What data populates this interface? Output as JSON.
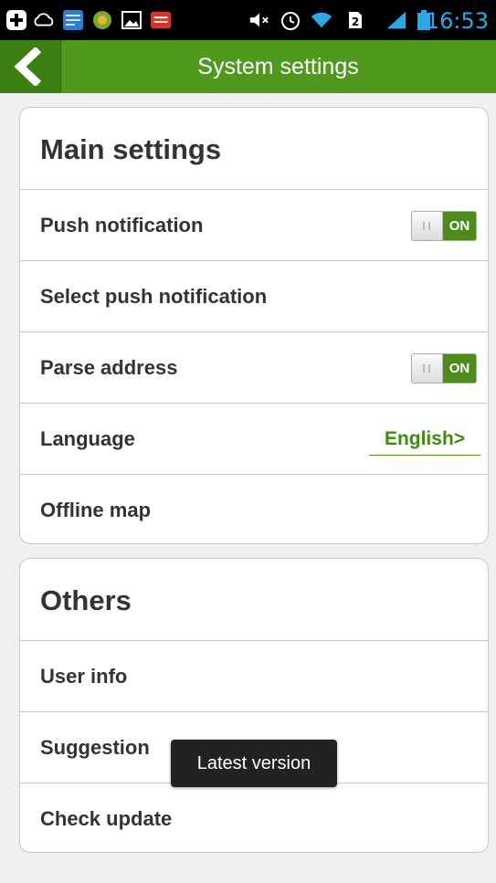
{
  "status_bar": {
    "time": "16:53",
    "icons": [
      "add-icon",
      "cloud-icon",
      "news-icon",
      "game-icon",
      "gallery-icon",
      "toutiao-icon",
      "mute-icon",
      "alarm-icon",
      "wifi-icon",
      "sim-icon",
      "signal-icon",
      "battery-icon"
    ]
  },
  "header": {
    "title": "System settings",
    "back_icon": "chevron-left-icon"
  },
  "main_settings": {
    "title": "Main settings",
    "items": [
      {
        "label": "Push notification",
        "toggle": "ON"
      },
      {
        "label": "Select push notification"
      },
      {
        "label": "Parse address",
        "toggle": "ON"
      },
      {
        "label": "Language",
        "value": "English>"
      },
      {
        "label": "Offline map"
      }
    ]
  },
  "others": {
    "title": "Others",
    "items": [
      {
        "label": "User info"
      },
      {
        "label": "Suggestion"
      },
      {
        "label": "Check update"
      }
    ]
  },
  "toast": {
    "text": "Latest version"
  },
  "colors": {
    "accent": "#4f9a1d",
    "accent_dark": "#3c7f12",
    "toggle_on": "#4f8b1c",
    "time": "#2aa9e6"
  }
}
